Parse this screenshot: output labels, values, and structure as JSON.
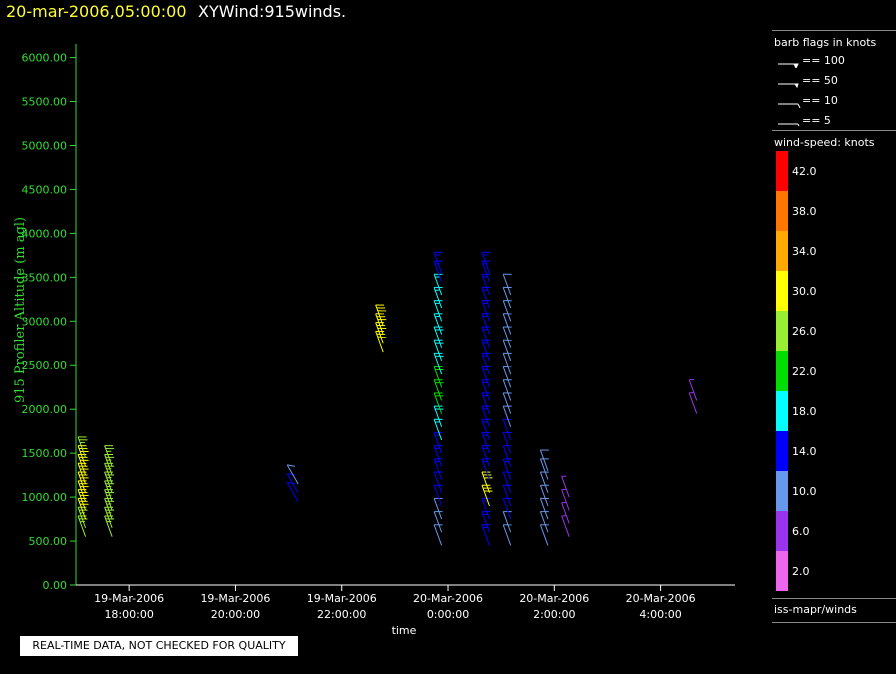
{
  "header": {
    "datetime": "20-mar-2006,05:00:00",
    "product": "XYWind:915winds."
  },
  "qc_notice": "REAL-TIME DATA, NOT CHECKED FOR QUALITY",
  "legend_barbs": {
    "title": "barb flags in knots",
    "items": [
      "== 100",
      "== 50",
      "== 10",
      "== 5"
    ]
  },
  "colorbar": {
    "title": "wind-speed: knots",
    "levels": [
      {
        "label": "42.0",
        "color": "#ff0000"
      },
      {
        "label": "38.0",
        "color": "#ff7700"
      },
      {
        "label": "34.0",
        "color": "#ffaa00"
      },
      {
        "label": "30.0",
        "color": "#ffff00"
      },
      {
        "label": "26.0",
        "color": "#99ee33"
      },
      {
        "label": "22.0",
        "color": "#00dd00"
      },
      {
        "label": "18.0",
        "color": "#00ffff"
      },
      {
        "label": "14.0",
        "color": "#0000ff"
      },
      {
        "label": "10.0",
        "color": "#6699ee"
      },
      {
        "label": "6.0",
        "color": "#9933ee"
      },
      {
        "label": "2.0",
        "color": "#ee66ee"
      }
    ]
  },
  "footer_label": "iss-mapr/winds",
  "chart_data": {
    "type": "scatter",
    "xlabel": "time",
    "ylabel": "915 Profiler Altitude (m agl)",
    "ylim": [
      0,
      6200
    ],
    "yticks": [
      "0.00",
      "500.00",
      "1000.00",
      "1500.00",
      "2000.00",
      "2500.00",
      "3000.00",
      "3500.00",
      "4000.00",
      "4500.00",
      "5000.00",
      "5500.00",
      "6000.00"
    ],
    "xticks": [
      {
        "date": "19-Mar-2006",
        "time": "18:00:00",
        "hour": 18
      },
      {
        "date": "19-Mar-2006",
        "time": "20:00:00",
        "hour": 20
      },
      {
        "date": "19-Mar-2006",
        "time": "22:00:00",
        "hour": 22
      },
      {
        "date": "20-Mar-2006",
        "time": "0:00:00",
        "hour": 24
      },
      {
        "date": "20-Mar-2006",
        "time": "2:00:00",
        "hour": 26
      },
      {
        "date": "20-Mar-2006",
        "time": "4:00:00",
        "hour": 28
      }
    ],
    "x_range_hours": [
      17.0,
      29.4
    ],
    "profiles": [
      {
        "hour": 17.18,
        "dir": 200,
        "points": [
          [
            550,
            27
          ],
          [
            650,
            27
          ],
          [
            750,
            28
          ],
          [
            850,
            28
          ],
          [
            950,
            28
          ],
          [
            1050,
            29
          ],
          [
            1150,
            29
          ],
          [
            1250,
            29
          ],
          [
            1350,
            28
          ],
          [
            1450,
            27
          ]
        ]
      },
      {
        "hour": 17.68,
        "dir": 200,
        "points": [
          [
            550,
            26
          ],
          [
            650,
            26
          ],
          [
            750,
            26
          ],
          [
            850,
            27
          ],
          [
            950,
            27
          ],
          [
            1050,
            27
          ],
          [
            1150,
            27
          ],
          [
            1250,
            26
          ],
          [
            1350,
            26
          ]
        ]
      },
      {
        "hour": 21.18,
        "dir": 210,
        "points": [
          [
            950,
            12
          ],
          [
            1050,
            12
          ],
          [
            1150,
            11
          ]
        ]
      },
      {
        "hour": 22.78,
        "dir": 200,
        "points": [
          [
            2650,
            28
          ],
          [
            2750,
            29
          ],
          [
            2850,
            29
          ],
          [
            2950,
            30
          ]
        ]
      },
      {
        "hour": 23.88,
        "dir": 200,
        "points": [
          [
            450,
            11
          ],
          [
            600,
            11
          ],
          [
            750,
            11
          ],
          [
            900,
            12
          ],
          [
            1050,
            12
          ],
          [
            1200,
            13
          ],
          [
            1350,
            13
          ],
          [
            1500,
            15
          ],
          [
            1650,
            16
          ],
          [
            1800,
            19
          ],
          [
            1950,
            21
          ],
          [
            2100,
            22
          ],
          [
            2250,
            20
          ],
          [
            2400,
            19
          ],
          [
            2550,
            19
          ],
          [
            2700,
            18
          ],
          [
            2850,
            17
          ],
          [
            3000,
            17
          ],
          [
            3150,
            16
          ],
          [
            3300,
            16
          ],
          [
            3450,
            15
          ],
          [
            3550,
            14
          ]
        ]
      },
      {
        "hour": 24.78,
        "dir": 200,
        "points": [
          [
            450,
            13
          ],
          [
            600,
            13
          ],
          [
            750,
            14
          ],
          [
            900,
            28
          ],
          [
            1050,
            29
          ],
          [
            1200,
            14
          ],
          [
            1350,
            13
          ],
          [
            1500,
            13
          ],
          [
            1650,
            14
          ],
          [
            1800,
            15
          ],
          [
            1950,
            15
          ],
          [
            2100,
            14
          ],
          [
            2250,
            14
          ],
          [
            2400,
            14
          ],
          [
            2550,
            15
          ],
          [
            2700,
            15
          ],
          [
            2850,
            15
          ],
          [
            3000,
            14
          ],
          [
            3150,
            14
          ],
          [
            3300,
            14
          ],
          [
            3450,
            13
          ],
          [
            3550,
            13
          ]
        ]
      },
      {
        "hour": 25.18,
        "dir": 200,
        "points": [
          [
            450,
            11
          ],
          [
            600,
            11
          ],
          [
            750,
            12
          ],
          [
            900,
            12
          ],
          [
            1050,
            12
          ],
          [
            1200,
            13
          ],
          [
            1350,
            12
          ],
          [
            1500,
            12
          ],
          [
            1650,
            12
          ],
          [
            1800,
            11
          ],
          [
            1950,
            11
          ],
          [
            2100,
            11
          ],
          [
            2250,
            11
          ],
          [
            2400,
            11
          ],
          [
            2550,
            10
          ],
          [
            2700,
            10
          ],
          [
            2850,
            11
          ],
          [
            3000,
            11
          ],
          [
            3150,
            11
          ],
          [
            3300,
            11
          ]
        ]
      },
      {
        "hour": 25.88,
        "dir": 200,
        "points": [
          [
            450,
            8
          ],
          [
            600,
            8
          ],
          [
            750,
            9
          ],
          [
            900,
            10
          ],
          [
            1050,
            10
          ],
          [
            1200,
            10
          ],
          [
            1300,
            8
          ]
        ]
      },
      {
        "hour": 26.28,
        "dir": 200,
        "points": [
          [
            550,
            7
          ],
          [
            700,
            7
          ],
          [
            850,
            6
          ],
          [
            1000,
            6
          ]
        ]
      },
      {
        "hour": 28.68,
        "dir": 200,
        "points": [
          [
            1950,
            7
          ],
          [
            2100,
            7
          ]
        ]
      }
    ]
  }
}
